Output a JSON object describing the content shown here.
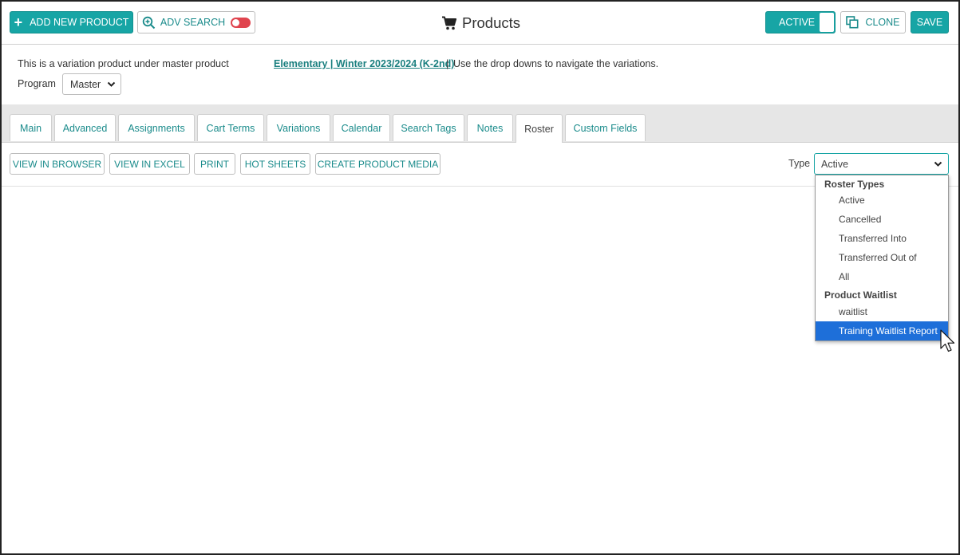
{
  "toolbar": {
    "add_new_product": "ADD NEW PRODUCT",
    "adv_search": "ADV SEARCH",
    "title": "Products",
    "active": "ACTIVE",
    "clone": "CLONE",
    "save": "SAVE"
  },
  "info": {
    "variation_text": "This is a variation product under master product",
    "master_link": "Elementary | Winter 2023/2024 (K-2nd)",
    "separator": "|",
    "note": "Use the drop downs to navigate the variations.",
    "program_label": "Program",
    "program_value": "Master"
  },
  "tabs": [
    {
      "label": "Main"
    },
    {
      "label": "Advanced"
    },
    {
      "label": "Assignments"
    },
    {
      "label": "Cart Terms"
    },
    {
      "label": "Variations"
    },
    {
      "label": "Calendar"
    },
    {
      "label": "Search Tags"
    },
    {
      "label": "Notes"
    },
    {
      "label": "Roster",
      "active": true
    },
    {
      "label": "Custom Fields"
    }
  ],
  "actions": {
    "view_in_browser": "VIEW IN BROWSER",
    "view_in_excel": "VIEW IN EXCEL",
    "print": "PRINT",
    "hot_sheets": "HOT SHEETS",
    "create_product_media": "CREATE PRODUCT MEDIA"
  },
  "type_filter": {
    "label": "Type",
    "value": "Active",
    "groups": [
      {
        "label": "Roster Types",
        "options": [
          "Active",
          "Cancelled",
          "Transferred Into",
          "Transferred Out of",
          "All"
        ]
      },
      {
        "label": "Product Waitlist",
        "options": [
          "waitlist",
          "Training Waitlist Report"
        ]
      }
    ],
    "highlighted": "Training Waitlist Report"
  },
  "colors": {
    "accent": "#17a5a5",
    "link": "#1a7f7f",
    "toggle_off": "#e0444e",
    "selection": "#1e6fd9"
  }
}
